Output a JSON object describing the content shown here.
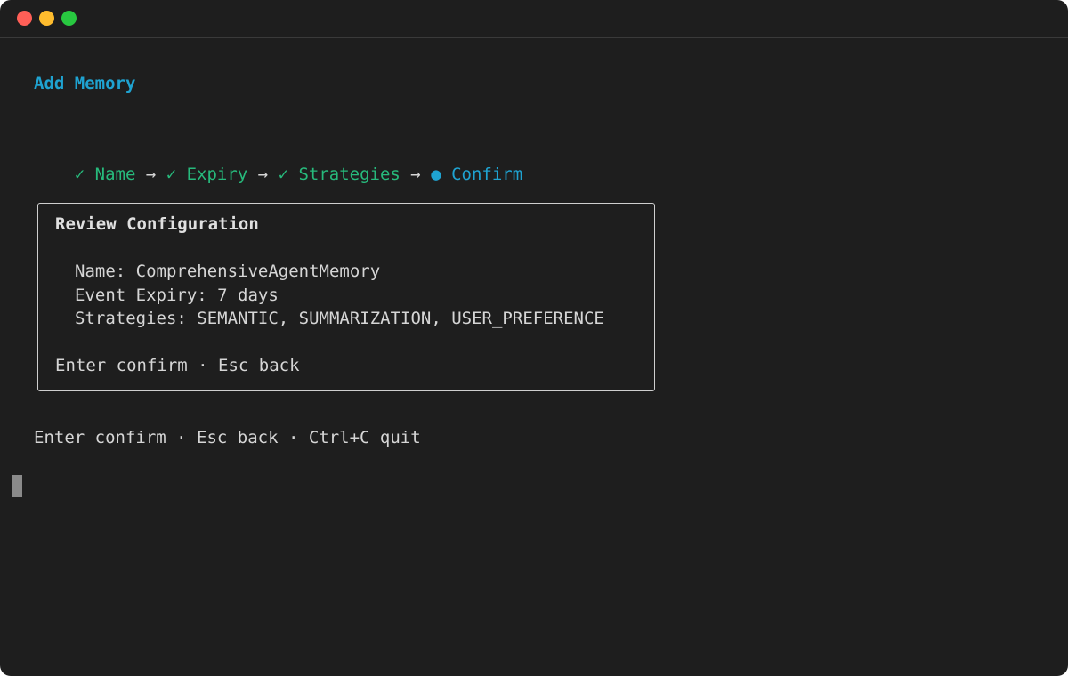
{
  "window": {
    "controls": [
      {
        "name": "close",
        "color": "#ff5f57"
      },
      {
        "name": "minimize",
        "color": "#febc2e"
      },
      {
        "name": "zoom",
        "color": "#28c840"
      }
    ]
  },
  "colors": {
    "accent": "#1fa3d1",
    "done": "#27ba7c",
    "text": "#d6d6d6",
    "background": "#1e1e1e"
  },
  "header": {
    "title": "Add Memory"
  },
  "wizard": {
    "steps": [
      {
        "label": "✓ Name",
        "status": "done"
      },
      {
        "label": "✓ Expiry",
        "status": "done"
      },
      {
        "label": "✓ Strategies",
        "status": "done"
      },
      {
        "label": "● Confirm",
        "status": "current"
      }
    ],
    "separator": " → "
  },
  "review": {
    "title": "Review Configuration",
    "name_line": "Name: ComprehensiveAgentMemory",
    "expiry_line": "Event Expiry: 7 days",
    "strategies_line": "Strategies: SEMANTIC, SUMMARIZATION, USER_PREFERENCE",
    "hint": "Enter confirm · Esc back"
  },
  "footer": {
    "hint": "Enter confirm · Esc back · Ctrl+C quit"
  }
}
